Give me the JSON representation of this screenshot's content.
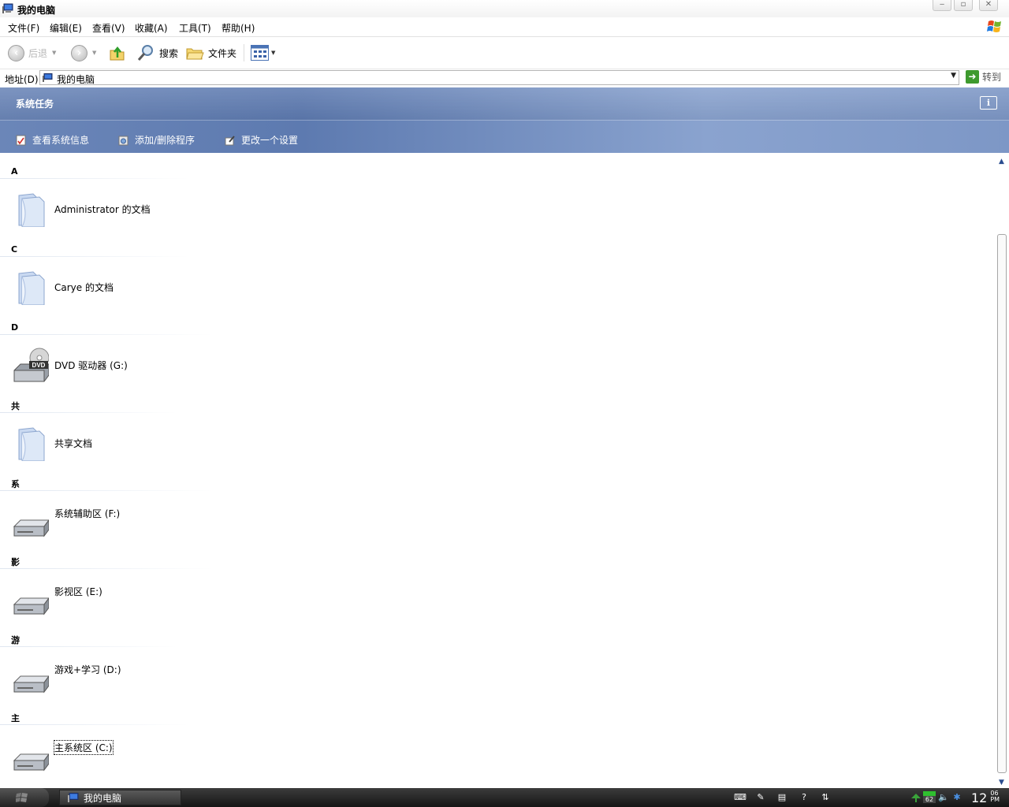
{
  "window": {
    "title": "我的电脑",
    "controls": {
      "minimize": "▭",
      "maximize": "▭",
      "close": "✕"
    }
  },
  "menu": [
    "文件(F)",
    "编辑(E)",
    "查看(V)",
    "收藏(A)",
    "工具(T)",
    "帮助(H)"
  ],
  "toolbar": {
    "back_label": "后退",
    "search_label": "搜索",
    "folders_label": "文件夹"
  },
  "address": {
    "label": "地址(D)",
    "value": "我的电脑",
    "go_label": "转到"
  },
  "task_panel": {
    "title": "系统任务",
    "info": "i",
    "links": [
      "查看系统信息",
      "添加/删除程序",
      "更改一个设置"
    ]
  },
  "groups": [
    {
      "header": "A",
      "item": "Administrator 的文档",
      "icon": "folder-icon"
    },
    {
      "header": "C",
      "item": "Carye 的文档",
      "icon": "folder-icon"
    },
    {
      "header": "D",
      "item": "DVD 驱动器 (G:)",
      "icon": "dvd-drive-icon",
      "badge": "DVD"
    },
    {
      "header": "共",
      "item": "共享文档",
      "icon": "folder-icon"
    },
    {
      "header": "系",
      "item": "系统辅助区 (F:)",
      "icon": "hard-drive-icon"
    },
    {
      "header": "影",
      "item": "影视区 (E:)",
      "icon": "hard-drive-icon"
    },
    {
      "header": "游",
      "item": "游戏+学习 (D:)",
      "icon": "hard-drive-icon"
    },
    {
      "header": "主",
      "item": "主系统区 (C:)",
      "icon": "hard-drive-icon",
      "selected": true
    }
  ],
  "taskbar": {
    "task_label": "我的电脑",
    "battery": "62",
    "clock_hour": "12",
    "clock_min": "06",
    "clock_ampm": "PM"
  }
}
